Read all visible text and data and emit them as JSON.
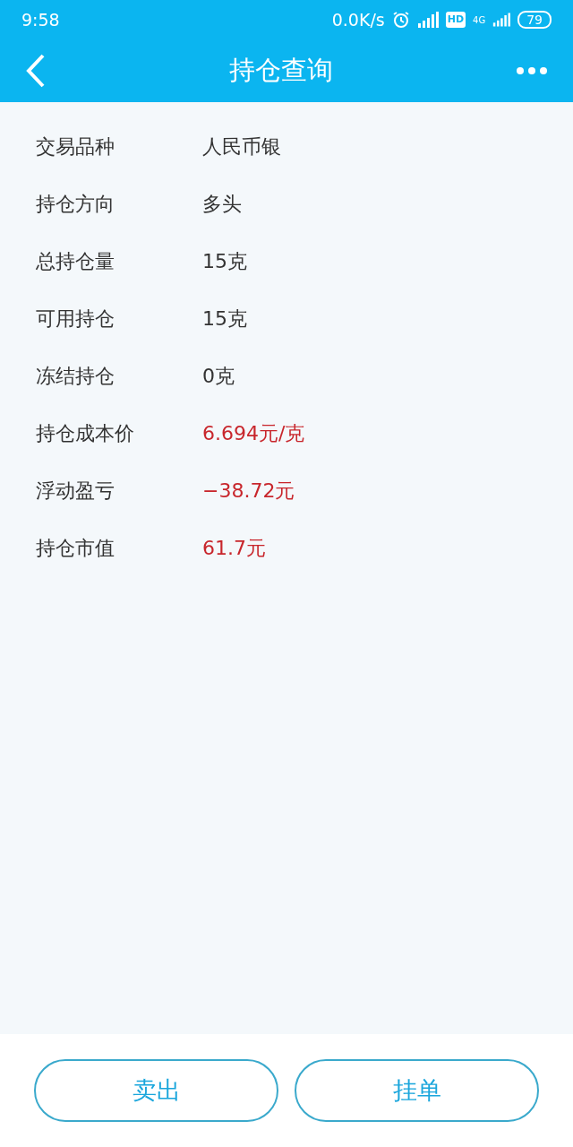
{
  "status_bar": {
    "time": "9:58",
    "speed": "0.0K/s",
    "hd": "HD",
    "network": "4G",
    "battery": "79"
  },
  "header": {
    "title": "持仓查询"
  },
  "fields": [
    {
      "label": "交易品种",
      "value": "人民币银",
      "kind": "plain"
    },
    {
      "label": "持仓方向",
      "value": "多头",
      "kind": "plain"
    },
    {
      "label": "总持仓量",
      "value": "15克",
      "kind": "plain"
    },
    {
      "label": "可用持仓",
      "value": "15克",
      "kind": "plain"
    },
    {
      "label": "冻结持仓",
      "value": "0克",
      "kind": "plain"
    },
    {
      "label": "持仓成本价",
      "value": "6.694元/克",
      "kind": "highlight"
    },
    {
      "label": "浮动盈亏",
      "value": "−38.72元",
      "kind": "highlight"
    },
    {
      "label": "持仓市值",
      "value": "61.7元",
      "kind": "highlight"
    }
  ],
  "buttons": [
    "卖出",
    "挂单"
  ]
}
